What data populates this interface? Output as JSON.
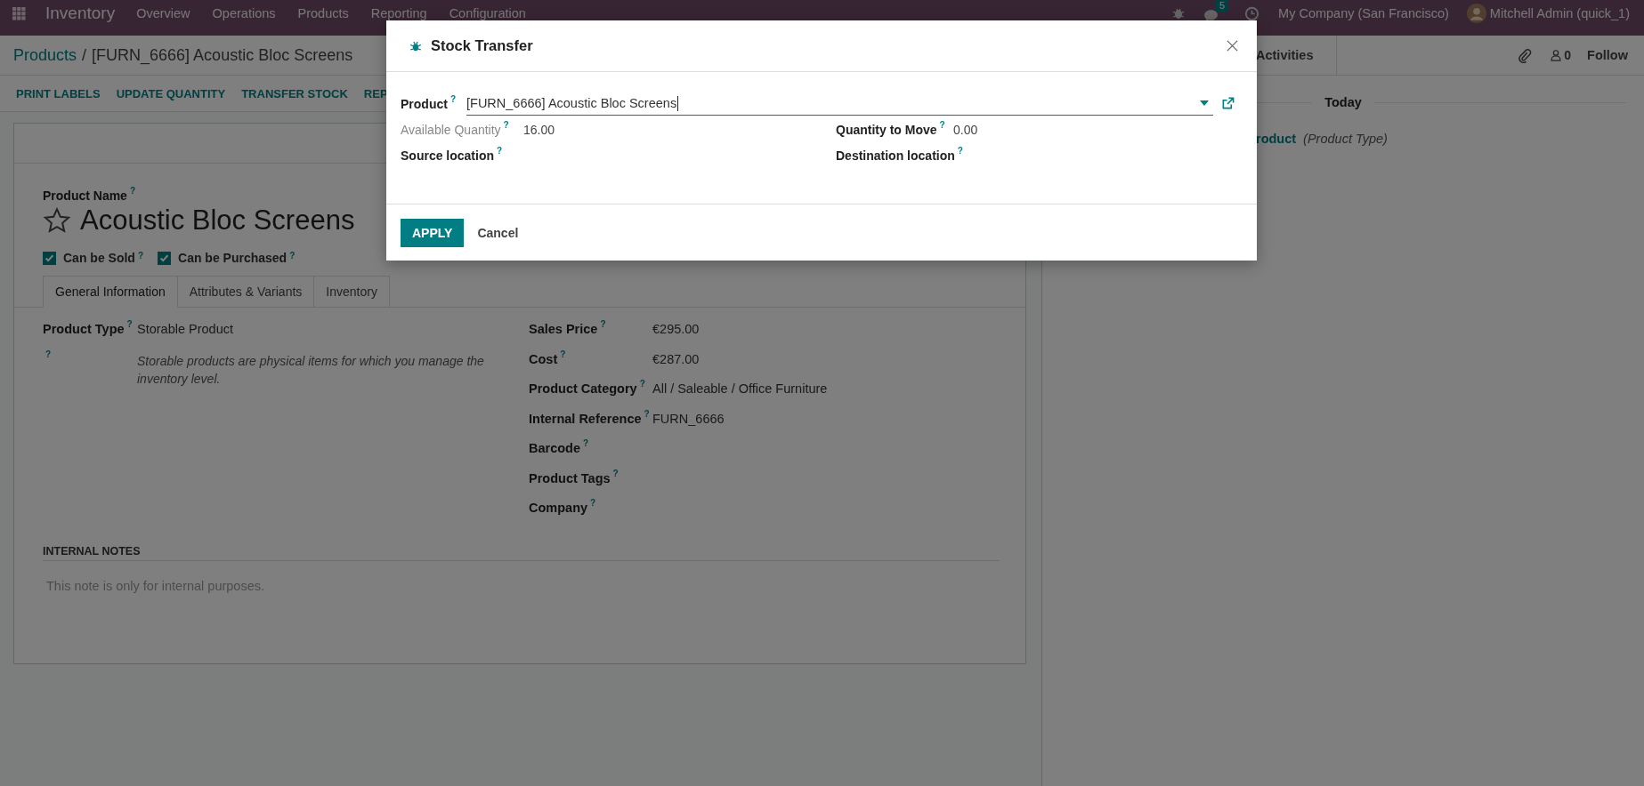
{
  "navbar": {
    "app": "Inventory",
    "menu": [
      "Overview",
      "Operations",
      "Products",
      "Reporting",
      "Configuration"
    ],
    "message_count": "5",
    "company": "My Company (San Francisco)",
    "user": "Mitchell Admin (quick_1)"
  },
  "breadcrumb": {
    "parent": "Products",
    "separator": "/",
    "current": "[FURN_6666] Acoustic Bloc Screens"
  },
  "actions": [
    "PRINT LABELS",
    "UPDATE QUANTITY",
    "TRANSFER STOCK",
    "REP"
  ],
  "form": {
    "name_label": "Product Name",
    "name_help": "?",
    "name": "Acoustic Bloc Screens",
    "favorite": false,
    "checkboxes": [
      {
        "label": "Can be Sold",
        "help": "?",
        "checked": true
      },
      {
        "label": "Can be Purchased",
        "help": "?",
        "checked": true
      }
    ],
    "tabs": [
      {
        "label": "General Information",
        "selected": true
      },
      {
        "label": "Attributes & Variants",
        "selected": false
      },
      {
        "label": "Inventory",
        "selected": false
      }
    ],
    "left_fields": [
      {
        "label": "Product Type",
        "help": "?",
        "value": "Storable Product"
      }
    ],
    "type_help_mark": "?",
    "type_help": "Storable products are physical items for which you manage the inventory level.",
    "right_fields": [
      {
        "label": "Sales Price",
        "help": "?",
        "value": "€295.00"
      },
      {
        "label": "Cost",
        "help": "?",
        "value": "€287.00"
      },
      {
        "label": "Product Category",
        "help": "?",
        "value": "All / Saleable / Office Furniture"
      },
      {
        "label": "Internal Reference",
        "help": "?",
        "value": "FURN_6666"
      },
      {
        "label": "Barcode",
        "help": "?"
      },
      {
        "label": "Product Tags",
        "help": "?"
      },
      {
        "label": "Company",
        "help": "?"
      }
    ],
    "notes": {
      "title": "INTERNAL NOTES",
      "placeholder": "This note is only for internal purposes."
    }
  },
  "chatter": {
    "activities": "Activities",
    "followers": "0",
    "follow": "Follow",
    "date": "Today",
    "message": {
      "link": "roduct",
      "field": "(Product Type)"
    }
  },
  "dialog": {
    "title": "Stock Transfer",
    "product": {
      "label": "Product",
      "help": "?",
      "value": "[FURN_6666] Acoustic Bloc Screens"
    },
    "fields": [
      {
        "label": "Available Quantity",
        "help": "?",
        "value": "16.00",
        "readonly": true
      },
      {
        "label": "Quantity to Move",
        "help": "?",
        "value": "0.00",
        "readonly": false
      },
      {
        "label": "Source location",
        "help": "?",
        "readonly": false
      },
      {
        "label": "Destination location",
        "help": "?",
        "readonly": false
      }
    ],
    "buttons": [
      {
        "label": "APPLY",
        "kind": "primary"
      },
      {
        "label": "Cancel",
        "kind": "secondary"
      }
    ]
  }
}
